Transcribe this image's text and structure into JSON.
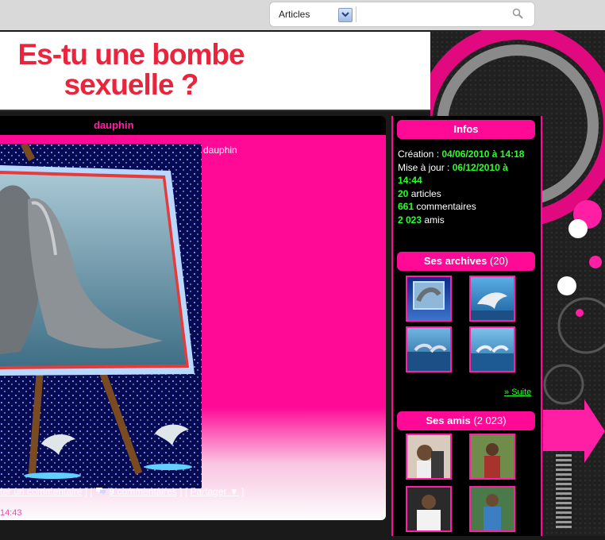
{
  "search": {
    "select_value": "Articles",
    "query": ""
  },
  "banner": {
    "title_line1": "Es-tu une bombe",
    "title_line2": "sexuelle ?"
  },
  "article": {
    "title": "dauphin",
    "caption": "dauphin",
    "comment_link": "ter un commentaire",
    "comments_count": "9",
    "comments_label": "commentaires",
    "share_label": "Partager ▼",
    "time": "14:43"
  },
  "sidebar": {
    "infos": {
      "title": "Infos",
      "created_label": "Création :",
      "created_value": "04/06/2010 à 14:18",
      "updated_label": "Mise à jour :",
      "updated_value": "06/12/2010 à 14:44",
      "articles_count": "20",
      "articles_label": "articles",
      "comments_count": "661",
      "comments_label": "commentaires",
      "friends_count": "2 023",
      "friends_label": "amis"
    },
    "archives": {
      "title": "Ses archives",
      "count": "(20)",
      "more_label": "Suite",
      "more_prefix": "»"
    },
    "friends": {
      "title": "Ses amis",
      "count": "(2 023)"
    }
  },
  "colors": {
    "accent_pink": "#ff0a97",
    "title_red": "#e8253d",
    "highlight_green": "#29ff29"
  }
}
